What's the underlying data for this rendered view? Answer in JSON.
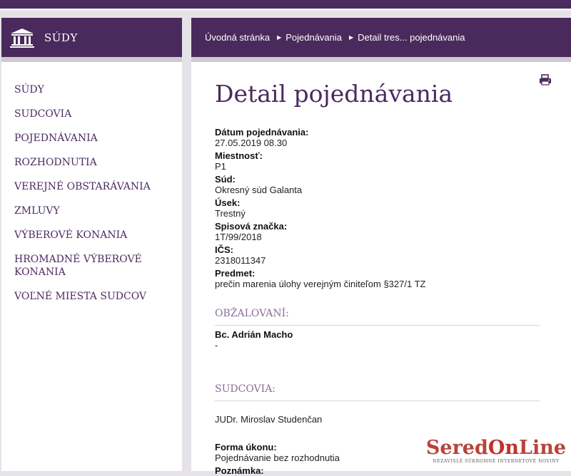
{
  "sidebar": {
    "title": "SÚDY",
    "items": [
      {
        "label": "SÚDY"
      },
      {
        "label": "SUDCOVIA"
      },
      {
        "label": "POJEDNÁVANIA"
      },
      {
        "label": "ROZHODNUTIA"
      },
      {
        "label": "VEREJNÉ OBSTARÁVANIA"
      },
      {
        "label": "ZMLUVY"
      },
      {
        "label": "VÝBEROVÉ KONANIA"
      },
      {
        "label": "HROMADNÉ VÝBEROVÉ KONANIA"
      },
      {
        "label": "VOĽNÉ MIESTA SUDCOV"
      }
    ]
  },
  "breadcrumb": {
    "items": [
      "Úvodná stránka",
      "Pojednávania",
      "Detail tres... pojednávania"
    ]
  },
  "page": {
    "title": "Detail pojednávania"
  },
  "fields": [
    {
      "label": "Dátum pojednávania:",
      "value": "27.05.2019 08.30"
    },
    {
      "label": "Miestnosť:",
      "value": "P1"
    },
    {
      "label": "Súd:",
      "value": "Okresný súd Galanta"
    },
    {
      "label": "Úsek:",
      "value": "Trestný"
    },
    {
      "label": "Spisová značka:",
      "value": "1T/99/2018"
    },
    {
      "label": "IČS:",
      "value": "2318011347"
    },
    {
      "label": "Predmet:",
      "value": "prečin marenia úlohy verejným činiteľom §327/1 TZ"
    }
  ],
  "accused": {
    "heading": "OBŽALOVANÍ:",
    "name": "Bc. Adrián Macho",
    "detail": "-"
  },
  "judges": {
    "heading": "SUDCOVIA:",
    "name": "JUDr. Miroslav Studenčan"
  },
  "form": {
    "label": "Forma úkonu:",
    "value": "Pojednávanie bez rozhodnutia",
    "next_label": "Poznámka:"
  },
  "watermark": {
    "brand_a": "Sered",
    "brand_b": "On",
    "brand_c": "Line",
    "tagline": "NEZÁVISLÉ SÚKROMNÉ INTERNETOVÉ NOVINY"
  },
  "colors": {
    "brand_purple": "#4a2a5c",
    "section_heading": "#8a6d97",
    "watermark_red": "#b8453b"
  },
  "icons": {
    "header": "courthouse-icon",
    "print": "print-icon",
    "breadcrumb_sep": "caret-right-icon"
  }
}
